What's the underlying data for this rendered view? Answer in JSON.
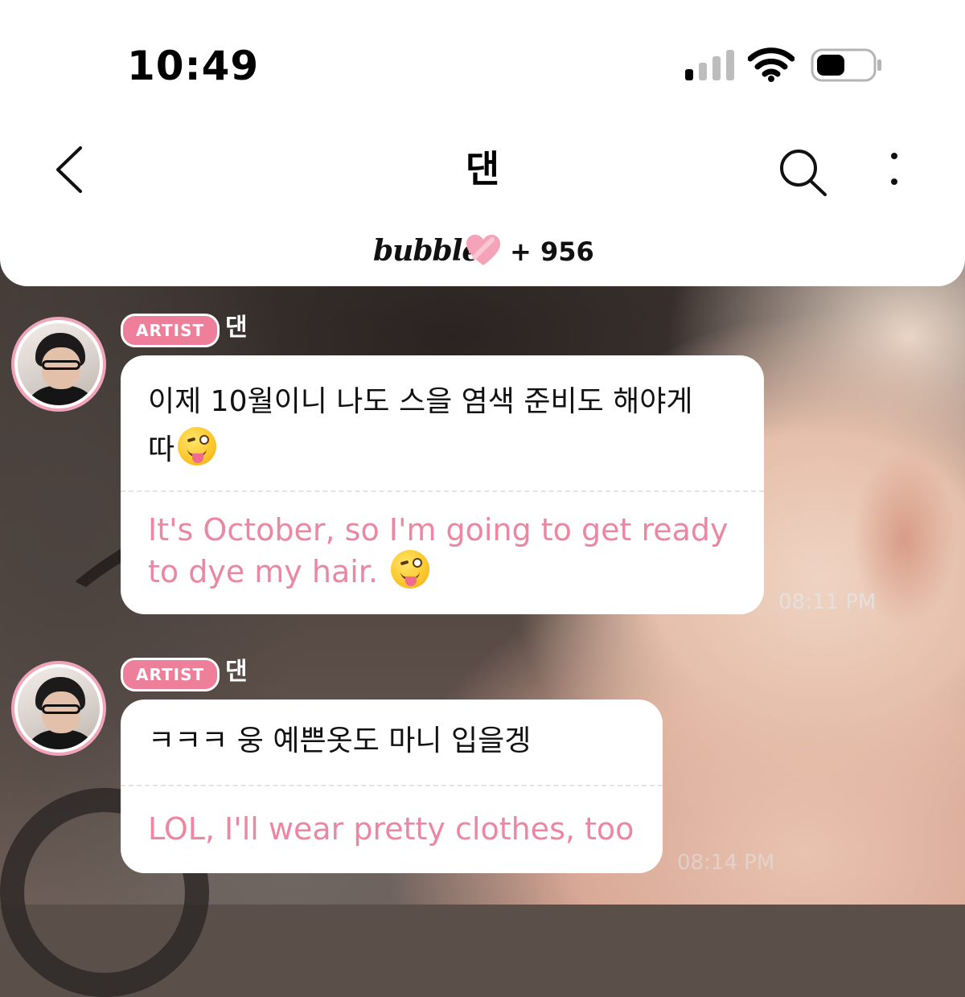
{
  "status_bar": {
    "time": "10:49"
  },
  "header": {
    "title": "댄",
    "back_icon": "chevron-left-icon",
    "search_icon": "search-icon",
    "more_icon": "more-vertical-icon"
  },
  "bubble_bar": {
    "logo": "bubble",
    "count": "+ 956",
    "heart_color": "#f4a3b8"
  },
  "messages": [
    {
      "badge": "ARTIST",
      "sender": "댄",
      "original": "이제 10월이니 나도 스을 염색 준비도 해야게",
      "original_tail": "따",
      "translated": "It's October, so I'm going to get ready",
      "translated_tail": "to dye my hair.",
      "emoji": "winking-tongue-emoji",
      "time": "08:11 PM"
    },
    {
      "badge": "ARTIST",
      "sender": "댄",
      "original": "ㅋㅋㅋ 웅 예쁜옷도 마니 입을겡",
      "translated": "LOL, I'll wear pretty clothes, too",
      "time": "08:14 PM"
    }
  ],
  "colors": {
    "accent_pink": "#ee7f9a",
    "translation_text": "#ec87a3",
    "avatar_ring": "#f0a4b9"
  }
}
